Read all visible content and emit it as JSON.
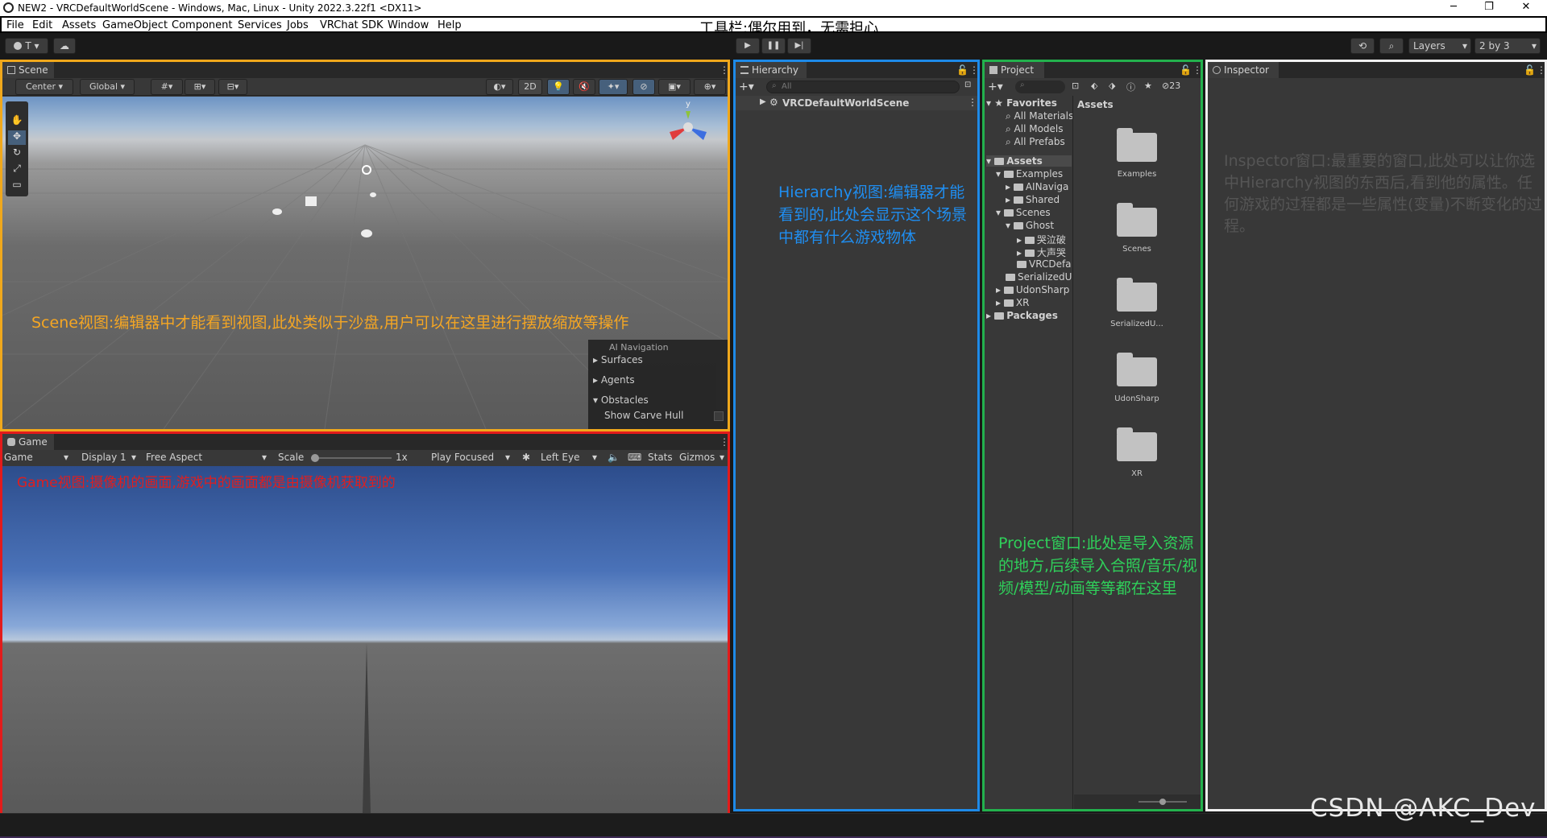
{
  "window": {
    "title": "NEW2 - VRCDefaultWorldScene - Windows, Mac, Linux - Unity 2022.3.22f1 <DX11>",
    "controls": [
      "─",
      "❐",
      "✕"
    ]
  },
  "menu": {
    "items": [
      "File",
      "Edit",
      "Assets",
      "GameObject",
      "Component",
      "Services",
      "Jobs",
      "VRChat SDK",
      "Window",
      "Help"
    ],
    "annotation": "工具栏:偶尔用到，无需担心"
  },
  "toolbar": {
    "account": "T",
    "layers": "Layers",
    "layout": "2 by 3"
  },
  "scene": {
    "tab": "Scene",
    "pivot": "Center",
    "space": "Global",
    "mode_2d": "2D",
    "axis_y": "y",
    "ai_nav": {
      "title": "AI Navigation",
      "items": [
        "Surfaces",
        "Agents",
        "Obstacles",
        "Show Carve Hull"
      ]
    },
    "annotation": "Scene视图:编辑器中才能看到视图,此处类似于沙盘,用户可以在这里进行摆放缩放等操作"
  },
  "game": {
    "tab": "Game",
    "mode": "Game",
    "display": "Display 1",
    "aspect": "Free Aspect",
    "scale_label": "Scale",
    "scale_value": "1x",
    "play_mode": "Play Focused",
    "eye": "Left Eye",
    "stats": "Stats",
    "gizmos": "Gizmos",
    "annotation": "Game视图:摄像机的画面,游戏中的画面都是由摄像机获取到的"
  },
  "hierarchy": {
    "tab": "Hierarchy",
    "search_placeholder": "All",
    "root": "VRCDefaultWorldScene",
    "annotation": "Hierarchy视图:编辑器才能看到的,此处会显示这个场景中都有什么游戏物体"
  },
  "project": {
    "tab": "Project",
    "hidden_count": "23",
    "favorites": {
      "label": "Favorites",
      "items": [
        "All Materials",
        "All Models",
        "All Prefabs"
      ]
    },
    "tree": {
      "assets": "Assets",
      "examples": "Examples",
      "ainav": "AINaviga",
      "shared": "Shared",
      "scenes": "Scenes",
      "ghost": "Ghost",
      "ghost_a": "哭泣破",
      "ghost_b": "大声哭",
      "vrcdefa": "VRCDefa",
      "serialized": "SerializedU",
      "udonsharp": "UdonSharp",
      "xr": "XR",
      "packages": "Packages"
    },
    "grid_header": "Assets",
    "grid": [
      "Examples",
      "Scenes",
      "SerializedU...",
      "UdonSharp",
      "XR"
    ],
    "annotation": "Project窗口:此处是导入资源的地方,后续导入合照/音乐/视频/模型/动画等等都在这里"
  },
  "inspector": {
    "tab": "Inspector",
    "annotation": "Inspector窗口:最重要的窗口,此处可以让你选中Hierarchy视图的东西后,看到他的属性。任何游戏的过程都是一些属性(变量)不断变化的过程。"
  },
  "watermark": "CSDN @AKC_Dev",
  "colors": {
    "scene_border": "#f0a81c",
    "game_border": "#e31b1b",
    "hierarchy_border": "#1e8ae8",
    "project_border": "#23b14d",
    "inspector_border": "#f0f0f0"
  }
}
